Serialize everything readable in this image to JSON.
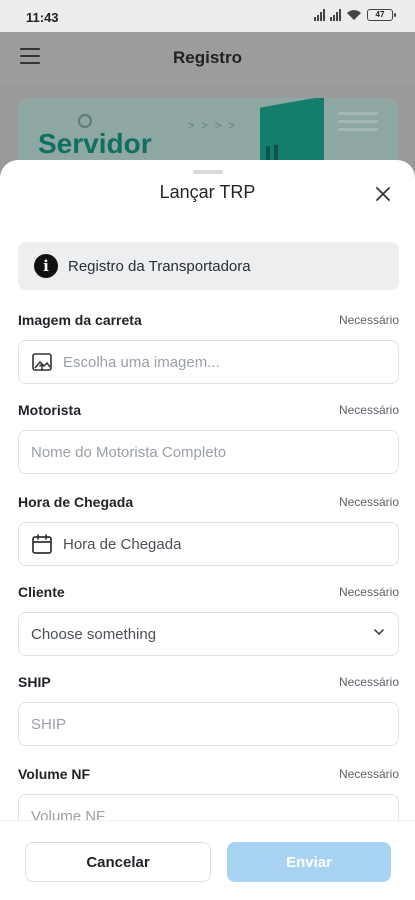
{
  "status_bar": {
    "time": "11:43",
    "battery": "47"
  },
  "app": {
    "title": "Registro",
    "banner_title": "Servidor",
    "banner_dots": "> > > >"
  },
  "sheet": {
    "title": "Lançar TRP",
    "info": "Registro da Transportadora",
    "fields": [
      {
        "label": "Imagem da carreta",
        "required": "Necessário",
        "placeholder": "Escolha uma imagem...",
        "icon": "image-upload-icon"
      },
      {
        "label": "Motorista",
        "required": "Necessário",
        "placeholder": "Nome do Motorista Completo"
      },
      {
        "label": "Hora de Chegada",
        "required": "Necessário",
        "placeholder": "Hora de Chegada",
        "icon": "calendar-icon"
      },
      {
        "label": "Cliente",
        "required": "Necessário",
        "value": "Choose something",
        "icon": "chevron-down-icon"
      },
      {
        "label": "SHIP",
        "required": "Necessário",
        "placeholder": "SHIP"
      },
      {
        "label": "Volume NF",
        "required": "Necessário",
        "placeholder": "Volume NF"
      }
    ],
    "buttons": {
      "cancel": "Cancelar",
      "send": "Enviar"
    }
  },
  "colors": {
    "accent_disabled": "#a9d3f2",
    "brand": "#137e6b"
  }
}
